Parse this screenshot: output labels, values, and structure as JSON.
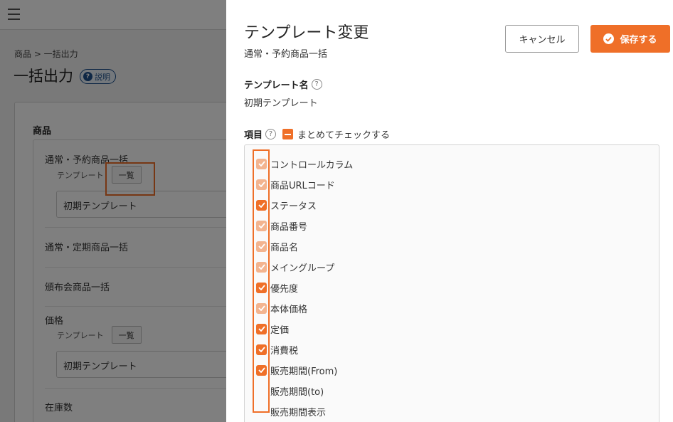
{
  "background": {
    "breadcrumb": "商品 > 一括出力",
    "page_title": "一括出力",
    "help_label": "説明",
    "card_title": "商品",
    "sections": [
      {
        "label": "通常・予約商品一括",
        "template_label": "テンプレート",
        "list_button": "一覧",
        "selected": "初期テンプレート"
      },
      {
        "label": "通常・定期商品一括"
      },
      {
        "label": "頒布会商品一括"
      },
      {
        "label": "価格",
        "template_label": "テンプレート",
        "list_button": "一覧",
        "selected": "初期テンプレート"
      },
      {
        "label": "在庫数"
      }
    ]
  },
  "drawer": {
    "title": "テンプレート変更",
    "subtitle": "通常・予約商品一括",
    "cancel_label": "キャンセル",
    "save_label": "保存する",
    "template_name_label": "テンプレート名",
    "template_name_value": "初期テンプレート",
    "items_label": "項目",
    "bulk_check_label": "まとめてチェックする",
    "items": [
      {
        "label": "コントロールカラム",
        "state": "disabled-checked"
      },
      {
        "label": "商品URLコード",
        "state": "disabled-checked"
      },
      {
        "label": "ステータス",
        "state": "checked"
      },
      {
        "label": "商品番号",
        "state": "disabled-checked"
      },
      {
        "label": "商品名",
        "state": "disabled-checked"
      },
      {
        "label": "メイングループ",
        "state": "disabled-checked"
      },
      {
        "label": "優先度",
        "state": "checked"
      },
      {
        "label": "本体価格",
        "state": "disabled-checked"
      },
      {
        "label": "定価",
        "state": "checked"
      },
      {
        "label": "消費税",
        "state": "checked"
      },
      {
        "label": "販売期間(From)",
        "state": "checked"
      },
      {
        "label": "販売期間(to)",
        "state": "unchecked"
      },
      {
        "label": "販売期間表示",
        "state": "unchecked"
      }
    ]
  },
  "colors": {
    "accent": "#ef6f28",
    "accent_light": "#f3b48f",
    "link": "#1c4f8a"
  }
}
